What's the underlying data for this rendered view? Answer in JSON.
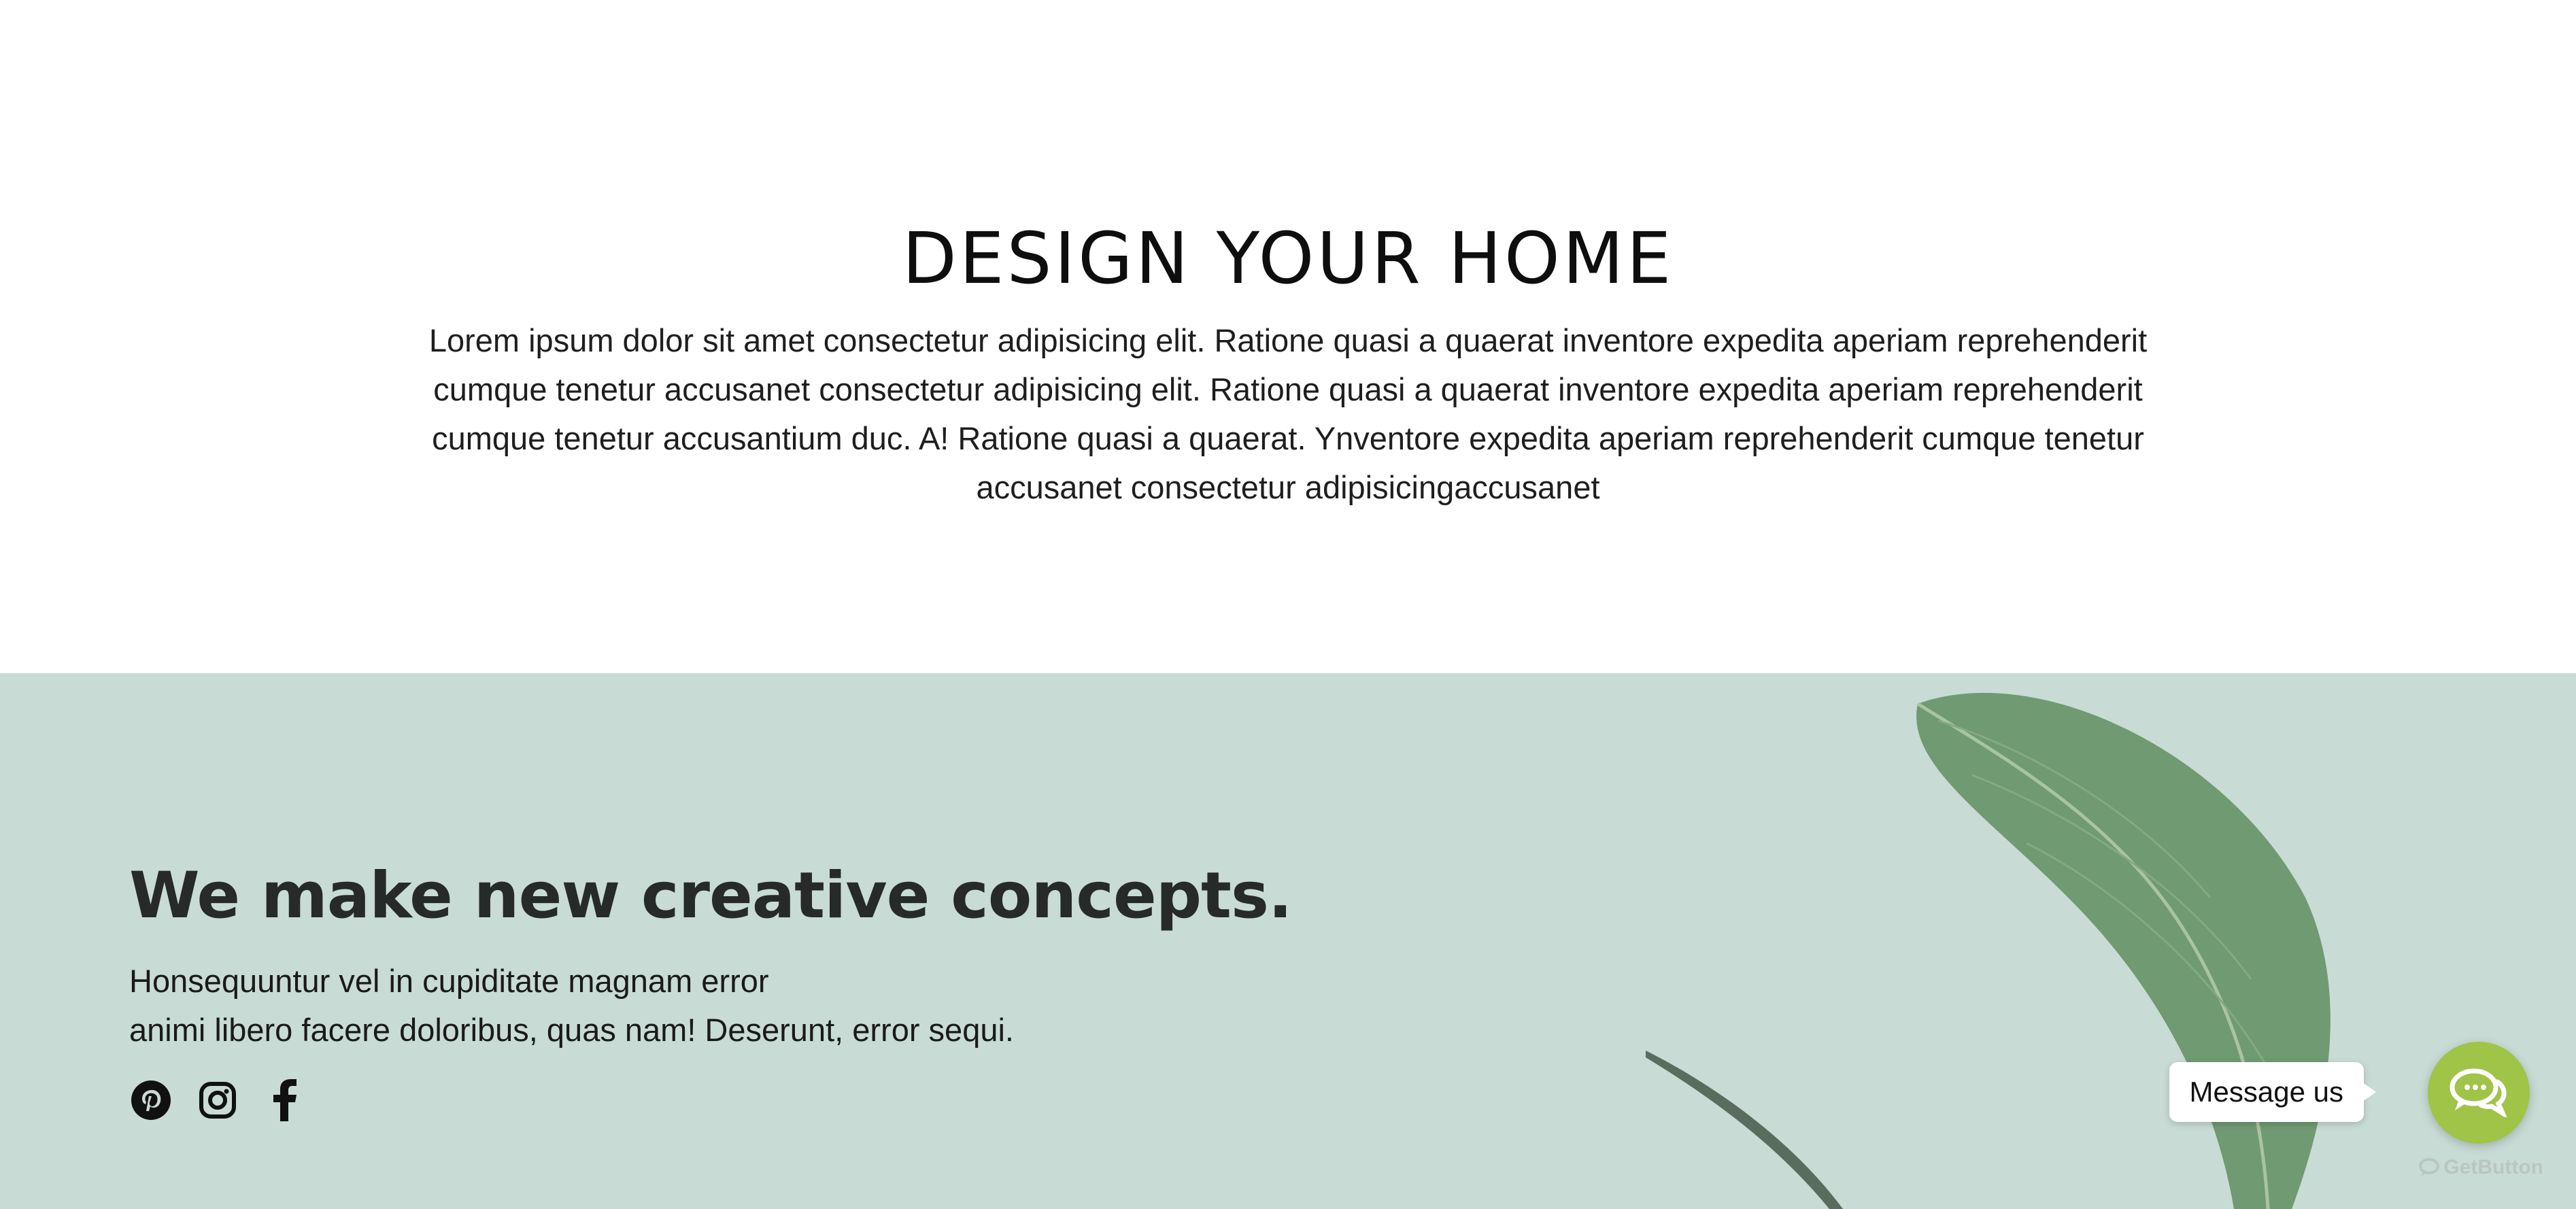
{
  "intro": {
    "title": "DESIGN YOUR HOME",
    "body": "Lorem ipsum dolor sit amet consectetur adipisicing elit. Ratione quasi a quaerat inventore expedita aperiam reprehenderit cumque tenetur accusanet consectetur adipisicing elit. Ratione quasi a quaerat inventore expedita aperiam reprehenderit cumque tenetur accusantium duc. A! Ratione quasi a quaerat. Ynventore expedita aperiam reprehenderit cumque tenetur accusanet consectetur adipisicingaccusanet"
  },
  "banner": {
    "title": "We make new creative concepts.",
    "text_line1": "Honsequuntur vel in cupiditate magnam error",
    "text_line2": "animi libero facere doloribus, quas nam! Deserunt, error sequi.",
    "background_color": "#c8dbd4",
    "social": [
      {
        "icon": "pinterest-icon"
      },
      {
        "icon": "instagram-icon"
      },
      {
        "icon": "facebook-icon"
      }
    ]
  },
  "chat_widget": {
    "label": "Message us",
    "brand": "GetButton",
    "button_color": "#9fc448"
  }
}
